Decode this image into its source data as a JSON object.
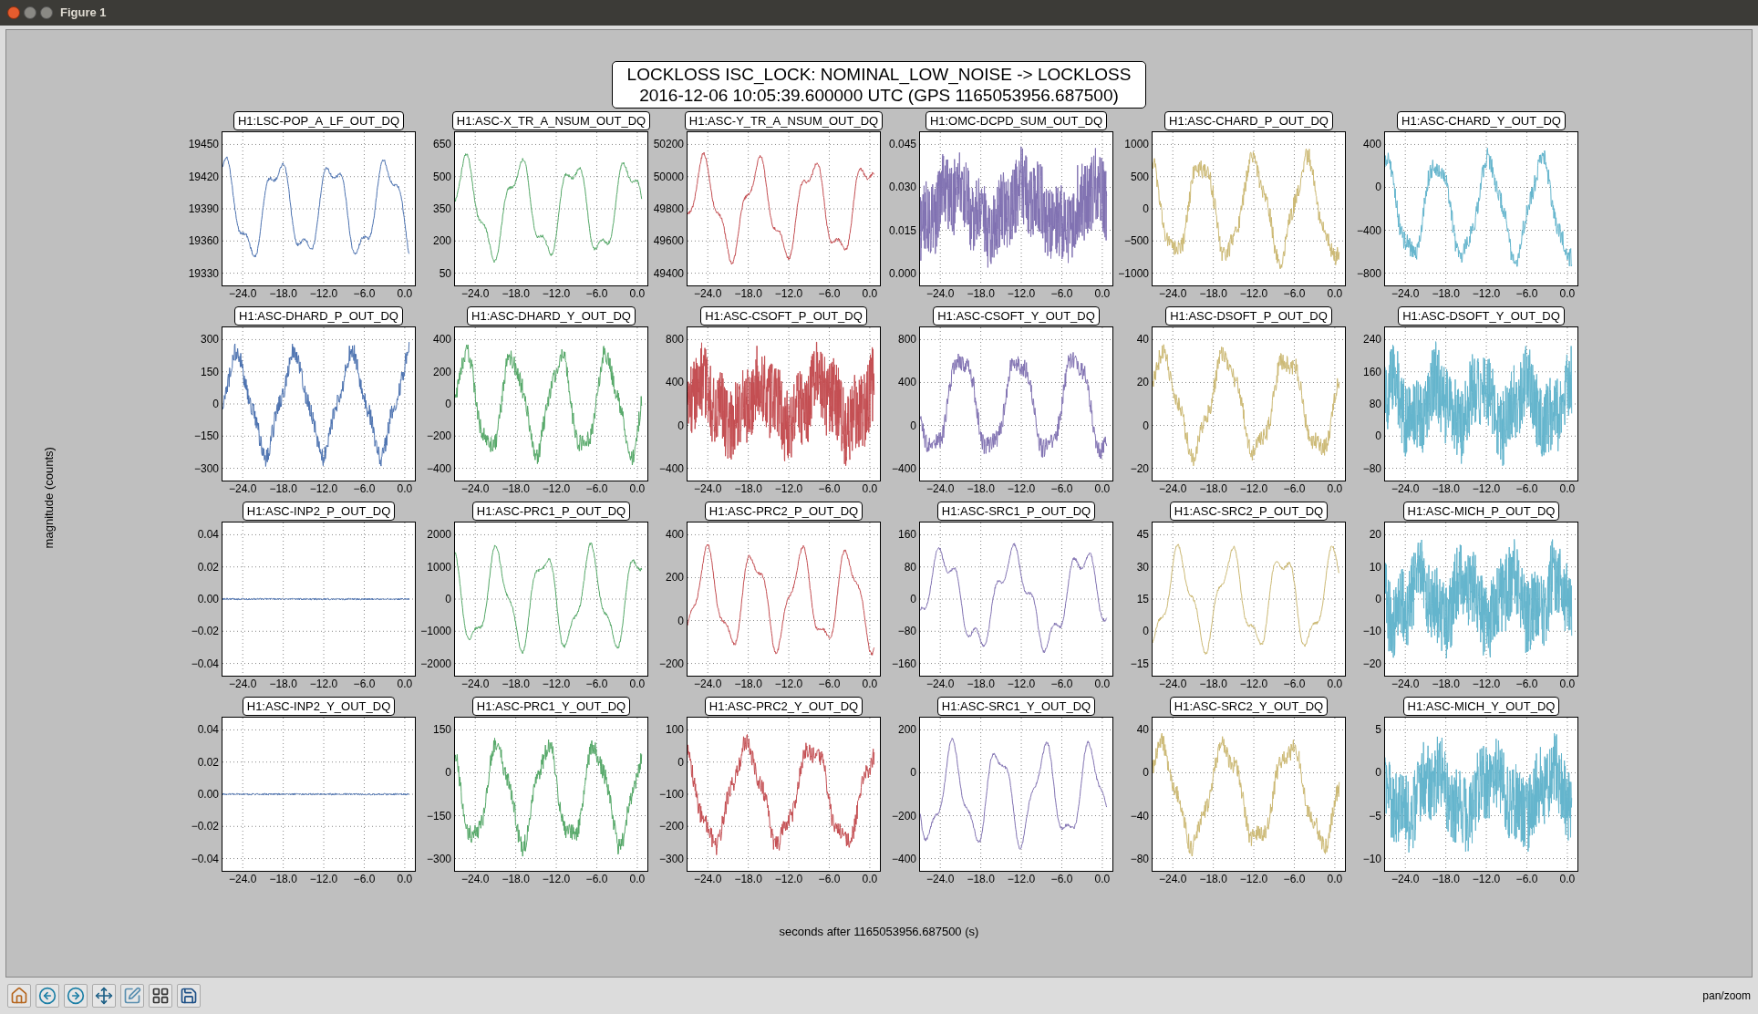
{
  "window": {
    "title": "Figure 1"
  },
  "figure": {
    "title": "LOCKLOSS ISC_LOCK: NOMINAL_LOW_NOISE -> LOCKLOSS",
    "subtitle": "2016-12-06 10:05:39.600000 UTC (GPS 1165053956.687500)",
    "ylabel": "magnitude (counts)",
    "xlabel": "seconds after 1165053956.687500 (s)",
    "plots": [
      {
        "title": "H1:LSC-POP_A_LF_OUT_DQ",
        "color": "#4c72b0",
        "kind": "smooth",
        "yticks": [
          "19450",
          "19420",
          "19390",
          "19360",
          "19330"
        ],
        "xticks": [
          "−24.0",
          "−18.0",
          "−12.0",
          "−6.0",
          "0.0"
        ]
      },
      {
        "title": "H1:ASC-X_TR_A_NSUM_OUT_DQ",
        "color": "#55a868",
        "kind": "smooth",
        "yticks": [
          "650",
          "500",
          "350",
          "200",
          "50"
        ],
        "xticks": [
          "−24.0",
          "−18.0",
          "−12.0",
          "−6.0",
          "0.0"
        ]
      },
      {
        "title": "H1:ASC-Y_TR_A_NSUM_OUT_DQ",
        "color": "#c44e52",
        "kind": "smooth",
        "yticks": [
          "50200",
          "50000",
          "49800",
          "49600",
          "49400"
        ],
        "xticks": [
          "−24.0",
          "−18.0",
          "−12.0",
          "−6.0",
          "0.0"
        ]
      },
      {
        "title": "H1:OMC-DCPD_SUM_OUT_DQ",
        "color": "#8172b2",
        "kind": "noisy",
        "yticks": [
          "0.045",
          "0.030",
          "0.015",
          "0.000"
        ],
        "xticks": [
          "−24.0",
          "−18.0",
          "−12.0",
          "−6.0",
          "0.0"
        ]
      },
      {
        "title": "H1:ASC-CHARD_P_OUT_DQ",
        "color": "#ccb974",
        "kind": "wavy",
        "yticks": [
          "1000",
          "500",
          "0",
          "−500",
          "−1000"
        ],
        "xticks": [
          "−24.0",
          "−18.0",
          "−12.0",
          "−6.0",
          "0.0"
        ]
      },
      {
        "title": "H1:ASC-CHARD_Y_OUT_DQ",
        "color": "#64b5cd",
        "kind": "wavy",
        "yticks": [
          "400",
          "0",
          "−400",
          "−800"
        ],
        "xticks": [
          "−24.0",
          "−18.0",
          "−12.0",
          "−6.0",
          "0.0"
        ]
      },
      {
        "title": "H1:ASC-DHARD_P_OUT_DQ",
        "color": "#4c72b0",
        "kind": "wavy",
        "yticks": [
          "300",
          "150",
          "0",
          "−150",
          "−300"
        ],
        "xticks": [
          "−24.0",
          "−18.0",
          "−12.0",
          "−6.0",
          "0.0"
        ]
      },
      {
        "title": "H1:ASC-DHARD_Y_OUT_DQ",
        "color": "#55a868",
        "kind": "wavy",
        "yticks": [
          "400",
          "200",
          "0",
          "−200",
          "−400"
        ],
        "xticks": [
          "−24.0",
          "−18.0",
          "−12.0",
          "−6.0",
          "0.0"
        ]
      },
      {
        "title": "H1:ASC-CSOFT_P_OUT_DQ",
        "color": "#c44e52",
        "kind": "noisy",
        "yticks": [
          "800",
          "400",
          "0",
          "−400"
        ],
        "xticks": [
          "−24.0",
          "−18.0",
          "−12.0",
          "−6.0",
          "0.0"
        ]
      },
      {
        "title": "H1:ASC-CSOFT_Y_OUT_DQ",
        "color": "#8172b2",
        "kind": "wavy",
        "yticks": [
          "800",
          "400",
          "0",
          "−400"
        ],
        "xticks": [
          "−24.0",
          "−18.0",
          "−12.0",
          "−6.0",
          "0.0"
        ]
      },
      {
        "title": "H1:ASC-DSOFT_P_OUT_DQ",
        "color": "#ccb974",
        "kind": "wavy",
        "yticks": [
          "40",
          "20",
          "0",
          "−20"
        ],
        "xticks": [
          "−24.0",
          "−18.0",
          "−12.0",
          "−6.0",
          "0.0"
        ]
      },
      {
        "title": "H1:ASC-DSOFT_Y_OUT_DQ",
        "color": "#64b5cd",
        "kind": "noisy",
        "yticks": [
          "240",
          "160",
          "80",
          "0",
          "−80"
        ],
        "xticks": [
          "−24.0",
          "−18.0",
          "−12.0",
          "−6.0",
          "0.0"
        ]
      },
      {
        "title": "H1:ASC-INP2_P_OUT_DQ",
        "color": "#4c72b0",
        "kind": "flat",
        "yticks": [
          "0.04",
          "0.02",
          "0.00",
          "−0.02",
          "−0.04"
        ],
        "xticks": [
          "−24.0",
          "−18.0",
          "−12.0",
          "−6.0",
          "0.0"
        ]
      },
      {
        "title": "H1:ASC-PRC1_P_OUT_DQ",
        "color": "#55a868",
        "kind": "smooth",
        "yticks": [
          "2000",
          "1000",
          "0",
          "−1000",
          "−2000"
        ],
        "xticks": [
          "−24.0",
          "−18.0",
          "−12.0",
          "−6.0",
          "0.0"
        ]
      },
      {
        "title": "H1:ASC-PRC2_P_OUT_DQ",
        "color": "#c44e52",
        "kind": "smooth",
        "yticks": [
          "400",
          "200",
          "0",
          "−200"
        ],
        "xticks": [
          "−24.0",
          "−18.0",
          "−12.0",
          "−6.0",
          "0.0"
        ]
      },
      {
        "title": "H1:ASC-SRC1_P_OUT_DQ",
        "color": "#8172b2",
        "kind": "smooth",
        "yticks": [
          "160",
          "80",
          "0",
          "−80",
          "−160"
        ],
        "xticks": [
          "−24.0",
          "−18.0",
          "−12.0",
          "−6.0",
          "0.0"
        ]
      },
      {
        "title": "H1:ASC-SRC2_P_OUT_DQ",
        "color": "#ccb974",
        "kind": "smooth",
        "yticks": [
          "45",
          "30",
          "15",
          "0",
          "−15"
        ],
        "xticks": [
          "−24.0",
          "−18.0",
          "−12.0",
          "−6.0",
          "0.0"
        ]
      },
      {
        "title": "H1:ASC-MICH_P_OUT_DQ",
        "color": "#64b5cd",
        "kind": "noisy",
        "yticks": [
          "20",
          "10",
          "0",
          "−10",
          "−20"
        ],
        "xticks": [
          "−24.0",
          "−18.0",
          "−12.0",
          "−6.0",
          "0.0"
        ]
      },
      {
        "title": "H1:ASC-INP2_Y_OUT_DQ",
        "color": "#4c72b0",
        "kind": "flat",
        "yticks": [
          "0.04",
          "0.02",
          "0.00",
          "−0.02",
          "−0.04"
        ],
        "xticks": [
          "−24.0",
          "−18.0",
          "−12.0",
          "−6.0",
          "0.0"
        ]
      },
      {
        "title": "H1:ASC-PRC1_Y_OUT_DQ",
        "color": "#55a868",
        "kind": "wavy",
        "yticks": [
          "150",
          "0",
          "−150",
          "−300"
        ],
        "xticks": [
          "−24.0",
          "−18.0",
          "−12.0",
          "−6.0",
          "0.0"
        ]
      },
      {
        "title": "H1:ASC-PRC2_Y_OUT_DQ",
        "color": "#c44e52",
        "kind": "wavy",
        "yticks": [
          "100",
          "0",
          "−100",
          "−200",
          "−300"
        ],
        "xticks": [
          "−24.0",
          "−18.0",
          "−12.0",
          "−6.0",
          "0.0"
        ]
      },
      {
        "title": "H1:ASC-SRC1_Y_OUT_DQ",
        "color": "#8172b2",
        "kind": "smooth",
        "yticks": [
          "200",
          "0",
          "−200",
          "−400"
        ],
        "xticks": [
          "−24.0",
          "−18.0",
          "−12.0",
          "−6.0",
          "0.0"
        ]
      },
      {
        "title": "H1:ASC-SRC2_Y_OUT_DQ",
        "color": "#ccb974",
        "kind": "wavy",
        "yticks": [
          "40",
          "0",
          "−40",
          "−80"
        ],
        "xticks": [
          "−24.0",
          "−18.0",
          "−12.0",
          "−6.0",
          "0.0"
        ]
      },
      {
        "title": "H1:ASC-MICH_Y_OUT_DQ",
        "color": "#64b5cd",
        "kind": "noisy",
        "yticks": [
          "5",
          "0",
          "−5",
          "−10"
        ],
        "xticks": [
          "−24.0",
          "−18.0",
          "−12.0",
          "−6.0",
          "0.0"
        ]
      }
    ]
  },
  "toolbar": {
    "buttons": [
      {
        "kind": "home"
      },
      {
        "kind": "back"
      },
      {
        "kind": "forward"
      },
      {
        "kind": "pan"
      },
      {
        "kind": "zoom"
      },
      {
        "kind": "subplots"
      },
      {
        "kind": "save"
      }
    ],
    "status": "pan/zoom"
  }
}
